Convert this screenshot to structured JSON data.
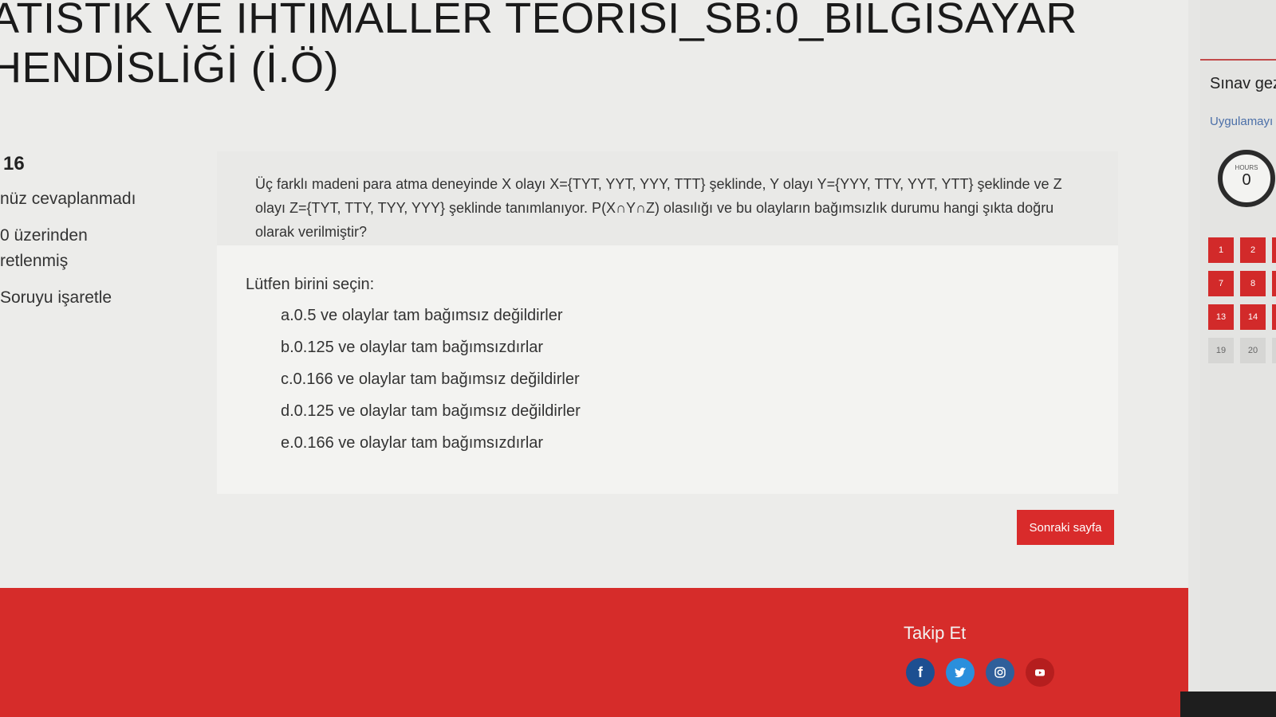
{
  "title": {
    "line1": "ATİSTİK VE İHTİMALLER TEORİSİ_SB:0_BİLGİSAYAR",
    "line2": "HENDİSLİĞİ (İ.Ö)"
  },
  "question_info": {
    "number": "16",
    "state": "nüz cevaplanmadı",
    "points_line1": "0 üzerinden",
    "points_line2": "retlenmiş",
    "flag_label": "Soruyu işaretle"
  },
  "question": {
    "text": "Üç farklı madeni para atma deneyinde X olayı X={TYT, YYT, YYY, TTT} şeklinde, Y olayı Y={YYY, TTY, YYT, YTT} şeklinde ve Z olayı Z={TYT, TTY, TYY, YYY} şeklinde tanımlanıyor. P(X∩Y∩Z) olasılığı ve bu olayların bağımsızlık durumu hangi şıkta doğru olarak verilmiştir?",
    "prompt": "Lütfen birini seçin:",
    "answers": [
      "a.0.5 ve olaylar tam bağımsız değildirler",
      "b.0.125 ve olaylar tam bağımsızdırlar",
      "c.0.166 ve olaylar tam bağımsız değildirler",
      "d.0.125 ve olaylar tam bağımsız değildirler",
      "e.0.166 ve olaylar tam bağımsızdırlar"
    ]
  },
  "next_button": "Sonraki sayfa",
  "footer": {
    "follow_label": "Takip Et",
    "socials": [
      {
        "name": "facebook",
        "glyph": "f"
      },
      {
        "name": "twitter",
        "glyph": "t"
      },
      {
        "name": "instagram",
        "glyph": ""
      },
      {
        "name": "youtube",
        "glyph": ""
      }
    ]
  },
  "nav": {
    "title": "Sınav gez",
    "link": "Uygulamayı",
    "timer_label": "HOURS",
    "timer_value": "0",
    "cells": [
      {
        "label": "1",
        "state": "red"
      },
      {
        "label": "2",
        "state": "red"
      },
      {
        "label": "",
        "state": "red"
      },
      {
        "label": "7",
        "state": "red"
      },
      {
        "label": "8",
        "state": "red"
      },
      {
        "label": "",
        "state": "red"
      },
      {
        "label": "13",
        "state": "red"
      },
      {
        "label": "14",
        "state": "red"
      },
      {
        "label": "",
        "state": "red"
      },
      {
        "label": "19",
        "state": "grey"
      },
      {
        "label": "20",
        "state": "grey"
      },
      {
        "label": "",
        "state": "grey"
      }
    ]
  },
  "colors": {
    "accent": "#d92b2b",
    "footer": "#d62c2a",
    "link": "#4b6fa8"
  }
}
